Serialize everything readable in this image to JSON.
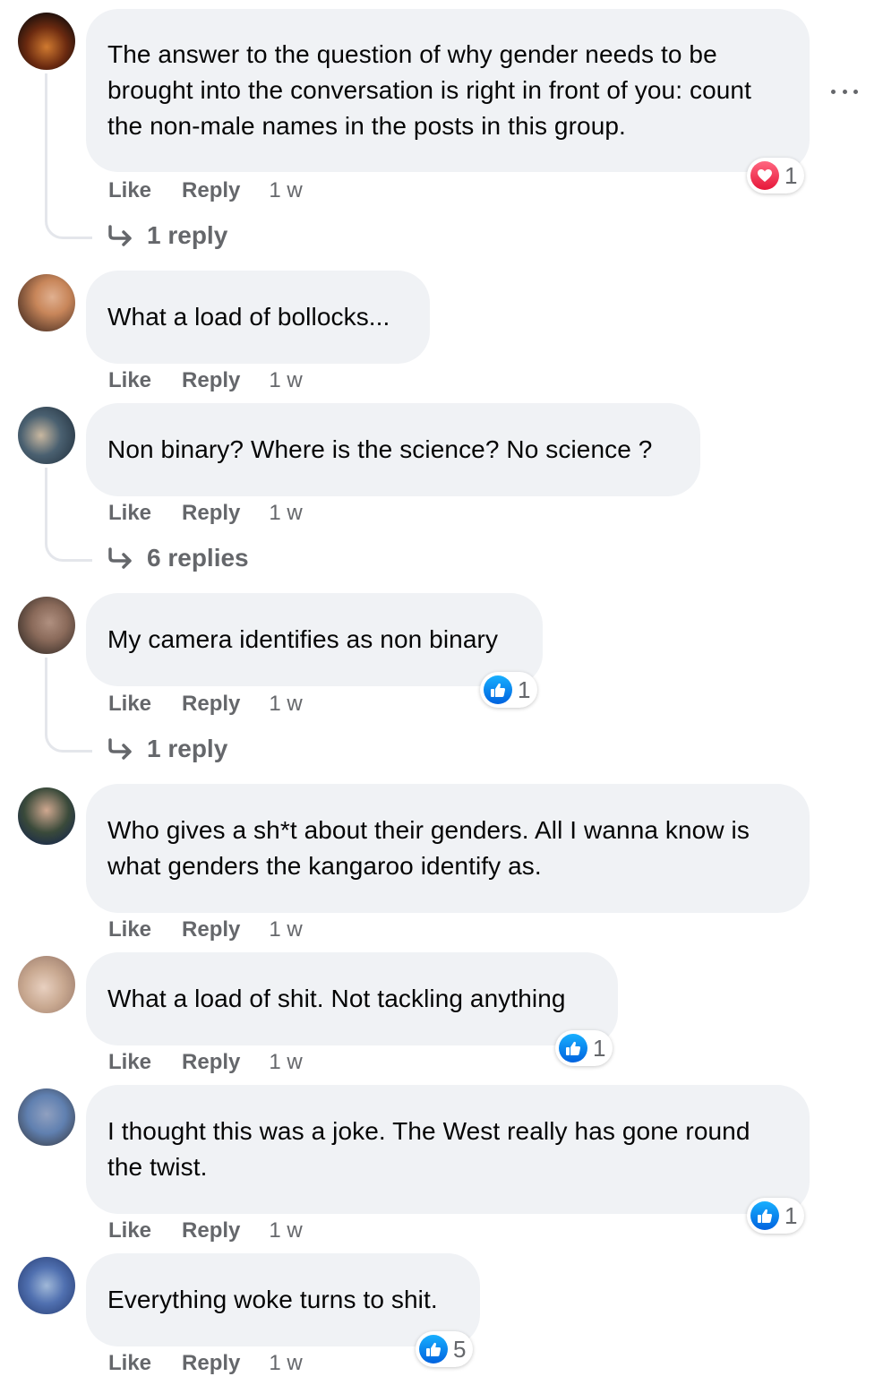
{
  "comments": [
    {
      "text": "The answer to the question of why gender needs to be brought into the conversation is right in front of you: count the non-male names in the posts in this group.",
      "like_label": "Like",
      "reply_label": "Reply",
      "time": "1 w",
      "reaction": {
        "type": "love",
        "count": "1"
      },
      "replies_label": "1 reply",
      "avatar_colors": [
        "#6b2a10",
        "#c86a2a",
        "#1a0f0c"
      ]
    },
    {
      "text": "What a load of bollocks...",
      "like_label": "Like",
      "reply_label": "Reply",
      "time": "1 w",
      "avatar_colors": [
        "#c8865a",
        "#5a3a2a",
        "#e0b090"
      ]
    },
    {
      "text": "Non binary? Where is the science? No science ?",
      "like_label": "Like",
      "reply_label": "Reply",
      "time": "1 w",
      "replies_label": "6 replies",
      "avatar_colors": [
        "#4a6070",
        "#c9b8a0",
        "#2a3a48"
      ]
    },
    {
      "text": "My camera identifies as non binary",
      "like_label": "Like",
      "reply_label": "Reply",
      "time": "1 w",
      "reaction": {
        "type": "like",
        "count": "1"
      },
      "replies_label": "1 reply",
      "avatar_colors": [
        "#8a6a5a",
        "#3a302a",
        "#b09080"
      ]
    },
    {
      "text": "Who gives a sh*t about their genders. All I wanna know is what genders the kangaroo identify as.",
      "like_label": "Like",
      "reply_label": "Reply",
      "time": "1 w",
      "avatar_colors": [
        "#3a4a3a",
        "#d0a890",
        "#1a2a4a"
      ]
    },
    {
      "text": "What a load of shit. Not tackling anything",
      "like_label": "Like",
      "reply_label": "Reply",
      "time": "1 w",
      "reaction": {
        "type": "like",
        "count": "1"
      },
      "avatar_colors": [
        "#c8a890",
        "#e8d0c0",
        "#a08070"
      ]
    },
    {
      "text": "I thought this was a joke. The West really has gone round the twist.",
      "like_label": "Like",
      "reply_label": "Reply",
      "time": "1 w",
      "reaction": {
        "type": "like",
        "count": "1"
      },
      "avatar_colors": [
        "#6080b0",
        "#404858",
        "#90a0c0"
      ]
    },
    {
      "text": "Everything woke turns to shit.",
      "like_label": "Like",
      "reply_label": "Reply",
      "time": "1 w",
      "reaction": {
        "type": "like",
        "count": "5"
      },
      "avatar_colors": [
        "#5070b0",
        "#a0b8d8",
        "#304880"
      ]
    }
  ],
  "colors": {
    "bubble": "#f0f2f5",
    "meta_text": "#65676b",
    "like_blue": "#1877f2",
    "love_red": "#f33e58"
  },
  "icons": {
    "more": "more-options-icon",
    "reply_arrow": "reply-arrow-icon",
    "like": "like-reaction-icon",
    "love": "love-reaction-icon"
  }
}
